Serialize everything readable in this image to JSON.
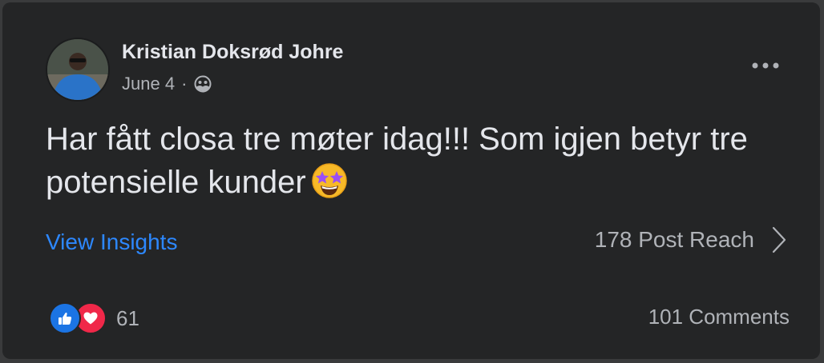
{
  "post": {
    "author": "Kristian Doksrød Johre",
    "date": "June 4",
    "separator": "·",
    "privacy_icon": "friends-icon",
    "text": "Har fått closa tre møter idag!!! Som igjen betyr tre potensielle kunder",
    "emoji": "star-struck-emoji",
    "menu_icon": "more-horizontal-icon"
  },
  "insights": {
    "link_label": "View Insights",
    "reach_label": "178 Post Reach"
  },
  "footer": {
    "reaction_icons": [
      "like-icon",
      "love-icon"
    ],
    "reaction_count": "61",
    "comments_label": "101 Comments"
  },
  "colors": {
    "card_background": "#242526",
    "page_background": "#3a3b3c",
    "primary_text": "#e4e6eb",
    "secondary_text": "#b0b3b8",
    "link": "#2d88ff",
    "like": "#1b74e4",
    "love": "#f02849"
  }
}
